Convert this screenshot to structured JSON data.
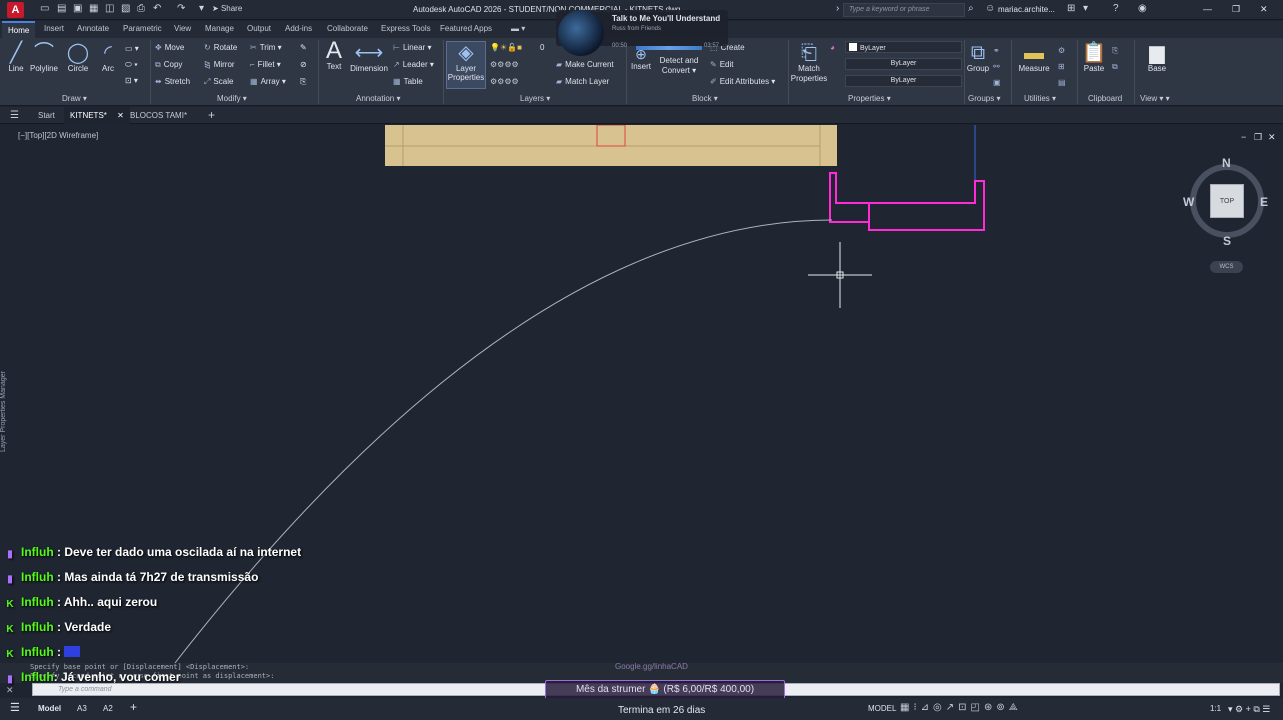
{
  "titlebar": {
    "logo": "A",
    "share": "Share",
    "title": "Autodesk AutoCAD 2026 - STUDENT/NON COMMERCIAL - KITNETS.dwg",
    "search_placeholder": "Type a keyword or phrase",
    "user": "mariac.archite..."
  },
  "ribbon_tabs": [
    "Home",
    "Insert",
    "Annotate",
    "Parametric",
    "View",
    "Manage",
    "Output",
    "Add-ins",
    "Collaborate",
    "Express Tools",
    "Featured Apps"
  ],
  "draw": {
    "line": "Line",
    "polyline": "Polyline",
    "circle": "Circle",
    "arc": "Arc",
    "panel": "Draw"
  },
  "modify": {
    "move": "Move",
    "rotate": "Rotate",
    "trim": "Trim",
    "copy": "Copy",
    "mirror": "Mirror",
    "fillet": "Fillet",
    "stretch": "Stretch",
    "scale": "Scale",
    "array": "Array",
    "panel": "Modify"
  },
  "annotation": {
    "text": "Text",
    "dimension": "Dimension",
    "linear": "Linear",
    "leader": "Leader",
    "table": "Table",
    "panel": "Annotation"
  },
  "layers": {
    "layer_properties_1": "Layer",
    "layer_properties_2": "Properties",
    "layer_value": "0",
    "make_current": "Make Current",
    "match_layer": "Match Layer",
    "panel": "Layers"
  },
  "block": {
    "insert": "Insert",
    "create": "Create",
    "edit": "Edit",
    "edit_attributes": "Edit Attributes",
    "detect_1": "Detect and",
    "detect_2": "Convert",
    "panel": "Block"
  },
  "properties": {
    "match_1": "Match",
    "match_2": "Properties",
    "bylayer1": "ByLayer",
    "bylayer2": "ByLayer",
    "bylayer3": "ByLayer",
    "panel": "Properties"
  },
  "groups": {
    "group": "Group",
    "panel": "Groups"
  },
  "utilities": {
    "measure": "Measure",
    "panel": "Utilities"
  },
  "clipboard": {
    "paste": "Paste",
    "panel": "Clipboard"
  },
  "view": {
    "base": "Base",
    "panel": "View"
  },
  "popup": {
    "title": "Talk to Me You'll Understand",
    "subtitle": "Russ from Friends",
    "time_elapsed": "00:50",
    "time_total": "03:57"
  },
  "doc_tabs": {
    "start": "Start",
    "kitnets": "KITNETS*",
    "blocos": "BLOCOS TAMI*"
  },
  "viewport": {
    "label": "[−][Top][2D Wireframe]",
    "side_label": "Layer Properties Manager"
  },
  "viewcube": {
    "n": "N",
    "s": "S",
    "e": "E",
    "w": "W",
    "top": "TOP",
    "wcs": "WCS"
  },
  "chat": [
    {
      "platform": "twitch",
      "name": "Influh",
      "text": ": Deve ter dado uma oscilada aí na internet"
    },
    {
      "platform": "twitch",
      "name": "Influh",
      "text": ": Mas ainda tá 7h27 de transmissão"
    },
    {
      "platform": "kick",
      "name": "Influh",
      "text": ": Ahh.. aqui zerou"
    },
    {
      "platform": "kick",
      "name": "Influh",
      "text": ": Verdade"
    },
    {
      "platform": "kick",
      "name": "Influh",
      "text": ":"
    },
    {
      "platform": "twitch",
      "name": "Influh",
      "text": ": Já venho, vou comer"
    }
  ],
  "command": {
    "history1": "Specify base point or [Displacement] <Displacement>:",
    "history2": "Specify second point or <use first point as displacement>:",
    "placeholder": "Type a command"
  },
  "sub_goal": {
    "top": "Google.gg/linhaCAD",
    "text": "Mês da strumer 🧁 (R$ 6,00/R$ 400,00)",
    "ends": "Termina em 26 dias"
  },
  "statusbar": {
    "model": "Model",
    "a3": "A3",
    "a2": "A2",
    "model_right": "MODEL",
    "scale": "1:1"
  },
  "colors": {
    "accent": "#4d7fdd",
    "magenta": "#ff2bd6",
    "tan": "#d8c28f",
    "chat_name": "#53fc18"
  }
}
